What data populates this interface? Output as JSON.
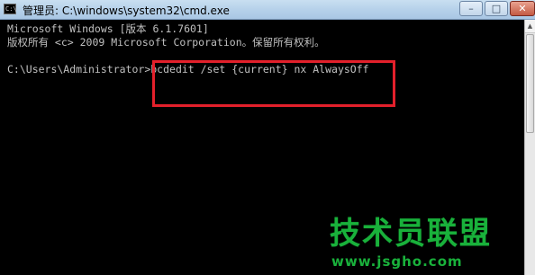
{
  "window": {
    "title": "管理员: C:\\windows\\system32\\cmd.exe",
    "icon_glyph": "C:\\",
    "controls": {
      "minimize": "–",
      "maximize": "□",
      "close": "✕"
    }
  },
  "console": {
    "lines": [
      "Microsoft Windows [版本 6.1.7601]",
      "版权所有 <c> 2009 Microsoft Corporation。保留所有权利。"
    ],
    "prompt": "C:\\Users\\Administrator>",
    "command": "bcdedit /set {current} nx AlwaysOff"
  },
  "scrollbar": {
    "up_arrow": "▲"
  },
  "watermark": {
    "title": "技术员联盟",
    "url": "www.jsgho.com"
  },
  "colors": {
    "console_bg": "#000000",
    "console_text": "#c0c0c0",
    "highlight": "#e3202b",
    "watermark": "#19b13b"
  }
}
